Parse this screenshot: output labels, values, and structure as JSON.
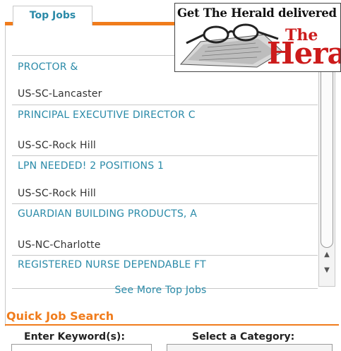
{
  "tab": {
    "label": "Top Jobs"
  },
  "ad": {
    "headline": "Get The Herald delivered",
    "logo_the": "The",
    "logo_herald": "Herald"
  },
  "jobs": [
    {
      "title": "PROCTOR &",
      "location": "US-SC-Lancaster"
    },
    {
      "title": "PRINCIPAL EXECUTIVE DIRECTOR C",
      "location": "US-SC-Rock Hill"
    },
    {
      "title": "LPN NEEDED! 2 POSITIONS 1",
      "location": "US-SC-Rock Hill"
    },
    {
      "title": "GUARDIAN BUILDING PRODUCTS, A",
      "location": "US-NC-Charlotte"
    },
    {
      "title": "REGISTERED NURSE DEPENDABLE FT",
      "location": ""
    }
  ],
  "see_more": "See More Top Jobs",
  "quick_search": {
    "title": "Quick Job Search",
    "keyword_label": "Enter Keyword(s):",
    "keyword_value": "",
    "category_label": "Select a Category:",
    "category_value": ""
  },
  "icons": {
    "scroll_up": "up-arrow-icon",
    "scroll_down": "down-arrow-icon"
  },
  "colors": {
    "accent": "#f07c1c",
    "link": "#2a8aa8",
    "ad_red": "#cc1b1b"
  }
}
